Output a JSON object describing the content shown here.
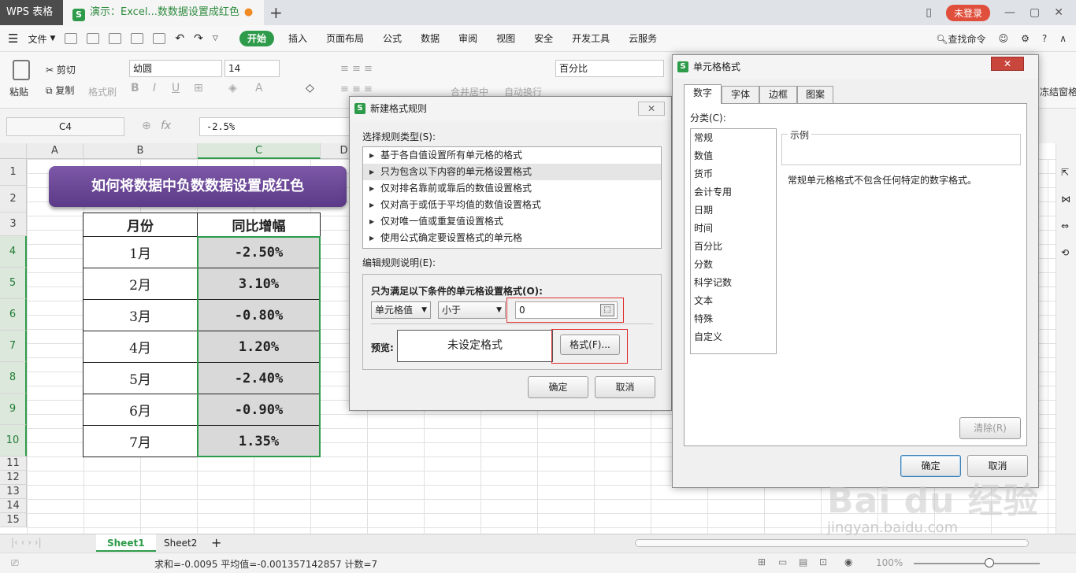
{
  "titlebar": {
    "app_tab": "WPS 表格",
    "doc_tab": "演示：Excel...数数据设置成红色",
    "login": "未登录"
  },
  "menubar": {
    "file": "文件",
    "tabs": [
      "开始",
      "插入",
      "页面布局",
      "公式",
      "数据",
      "审阅",
      "视图",
      "安全",
      "开发工具",
      "云服务"
    ],
    "search": "查找命令"
  },
  "toolbar": {
    "paste": "粘贴",
    "cut": "剪切",
    "copy": "复制",
    "format_painter": "格式刷",
    "font_name": "幼圆",
    "font_size": "14",
    "merge": "合并居中",
    "wrap": "自动换行",
    "number_format": "百分比",
    "freeze": "冻结窗格"
  },
  "formulabar": {
    "cell_ref": "C4",
    "fx": "fx",
    "formula": "-2.5%"
  },
  "sheet": {
    "columns": [
      "A",
      "B",
      "C"
    ],
    "column_d": "D",
    "rows": [
      "1",
      "2",
      "3",
      "4",
      "5",
      "6",
      "7",
      "8",
      "9",
      "10",
      "11",
      "12",
      "13",
      "14",
      "15"
    ],
    "banner": "如何将数据中负数数据设置成红色",
    "table": {
      "headers": [
        "月份",
        "同比增幅"
      ],
      "rows": [
        [
          "1月",
          "-2.50%"
        ],
        [
          "2月",
          "3.10%"
        ],
        [
          "3月",
          "-0.80%"
        ],
        [
          "4月",
          "1.20%"
        ],
        [
          "5月",
          "-2.40%"
        ],
        [
          "6月",
          "-0.90%"
        ],
        [
          "7月",
          "1.35%"
        ]
      ]
    }
  },
  "sheettabs": {
    "tab1": "Sheet1",
    "tab2": "Sheet2"
  },
  "statusbar": {
    "summary": "求和=-0.0095  平均值=-0.001357142857  计数=7",
    "zoom": "100%"
  },
  "dialog_rule": {
    "title": "新建格式规则",
    "select_type_label": "选择规则类型(S):",
    "rule_types": [
      "基于各自值设置所有单元格的格式",
      "只为包含以下内容的单元格设置格式",
      "仅对排名靠前或靠后的数值设置格式",
      "仅对高于或低于平均值的数值设置格式",
      "仅对唯一值或重复值设置格式",
      "使用公式确定要设置格式的单元格"
    ],
    "edit_label": "编辑规则说明(E):",
    "condition_label": "只为满足以下条件的单元格设置格式(O):",
    "cond_field": "单元格值",
    "cond_operator": "小于",
    "cond_value": "0",
    "preview_label": "预览:",
    "preview_text": "未设定格式",
    "format_btn": "格式(F)...",
    "ok": "确定",
    "cancel": "取消"
  },
  "dialog_format": {
    "title": "单元格格式",
    "tabs": [
      "数字",
      "字体",
      "边框",
      "图案"
    ],
    "category_label": "分类(C):",
    "categories": [
      "常规",
      "数值",
      "货币",
      "会计专用",
      "日期",
      "时间",
      "百分比",
      "分数",
      "科学记数",
      "文本",
      "特殊",
      "自定义"
    ],
    "sample_label": "示例",
    "description": "常规单元格格式不包含任何特定的数字格式。",
    "clear": "清除(R)",
    "ok": "确定",
    "cancel": "取消"
  },
  "watermark": {
    "main": "Bai du 经验",
    "sub": "jingyan.baidu.com"
  }
}
